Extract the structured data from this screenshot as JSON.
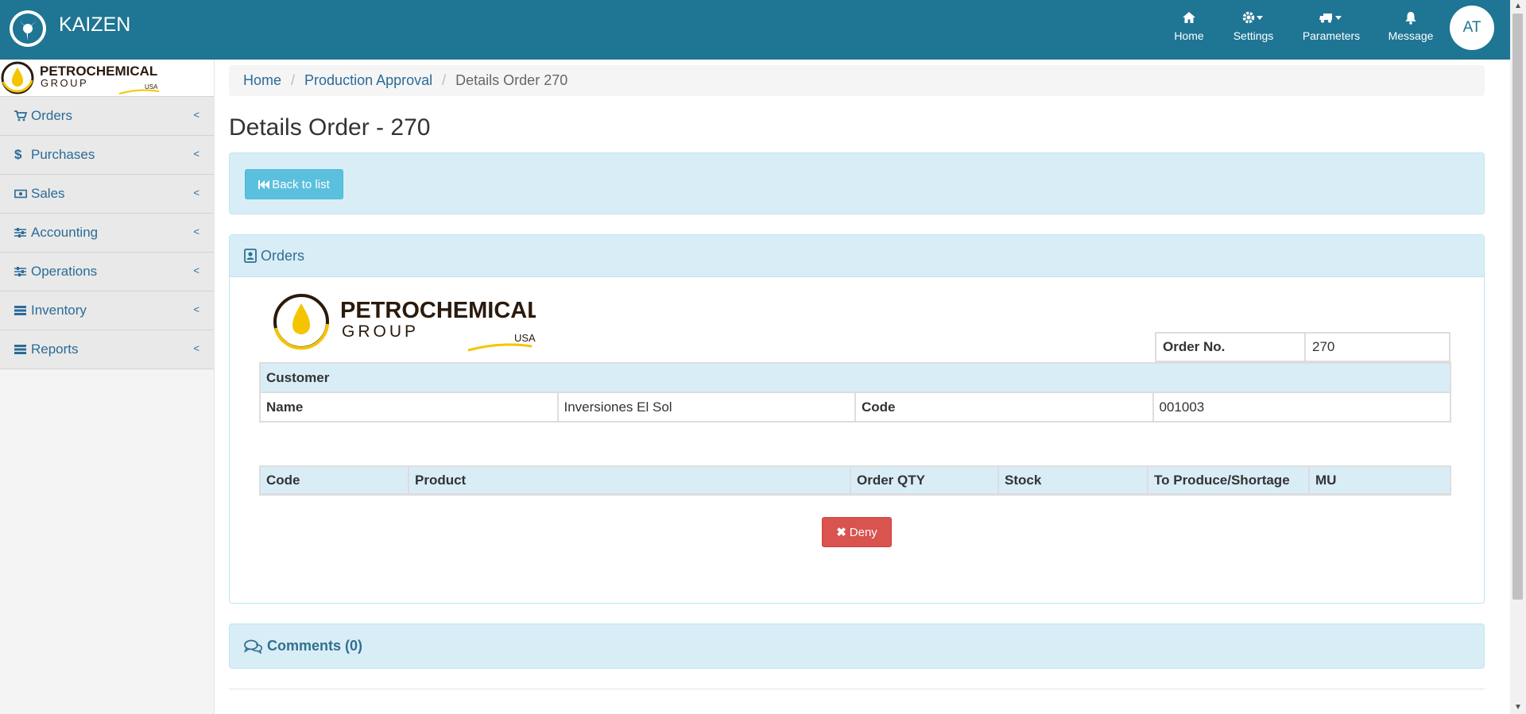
{
  "header": {
    "brand": "KAIZEN",
    "nav": [
      {
        "label": "Home",
        "icon": "home-icon"
      },
      {
        "label": "Settings",
        "icon": "gear-icon"
      },
      {
        "label": "Parameters",
        "icon": "truck-icon"
      },
      {
        "label": "Message",
        "icon": "bell-icon"
      }
    ],
    "avatar_initials": "AT"
  },
  "sidebar": {
    "logo": {
      "line1": "PETROCHEMICAL",
      "line2": "GROUP",
      "line3": "USA"
    },
    "items": [
      {
        "label": "Orders",
        "icon": "cart-icon"
      },
      {
        "label": "Purchases",
        "icon": "dollar-icon"
      },
      {
        "label": "Sales",
        "icon": "money-icon"
      },
      {
        "label": "Accounting",
        "icon": "sliders-icon"
      },
      {
        "label": "Operations",
        "icon": "sliders-icon"
      },
      {
        "label": "Inventory",
        "icon": "list-icon"
      },
      {
        "label": "Reports",
        "icon": "list-icon"
      }
    ]
  },
  "breadcrumb": {
    "home": "Home",
    "section": "Production Approval",
    "current": "Details Order 270"
  },
  "page_title": "Details Order - 270",
  "back_button": "Back to list",
  "orders_panel": {
    "title": "Orders",
    "logo": {
      "line1": "PETROCHEMICAL",
      "line2": "GROUP",
      "line3": "USA"
    },
    "order_no_label": "Order No.",
    "order_no_value": "270",
    "customer_header": "Customer",
    "name_label": "Name",
    "name_value": "Inversiones El Sol",
    "code_label": "Code",
    "code_value": "001003",
    "product_columns": [
      "Code",
      "Product",
      "Order QTY",
      "Stock",
      "To Produce/Shortage",
      "MU"
    ],
    "deny_button": "Deny"
  },
  "comments": {
    "label": "Comments (0)"
  },
  "colors": {
    "topbar": "#1f7594",
    "link": "#2a6b98",
    "panel_info": "#d9edf7",
    "btn_info": "#5bc0de",
    "btn_danger": "#d9534f",
    "logo_yellow": "#f5c400"
  }
}
